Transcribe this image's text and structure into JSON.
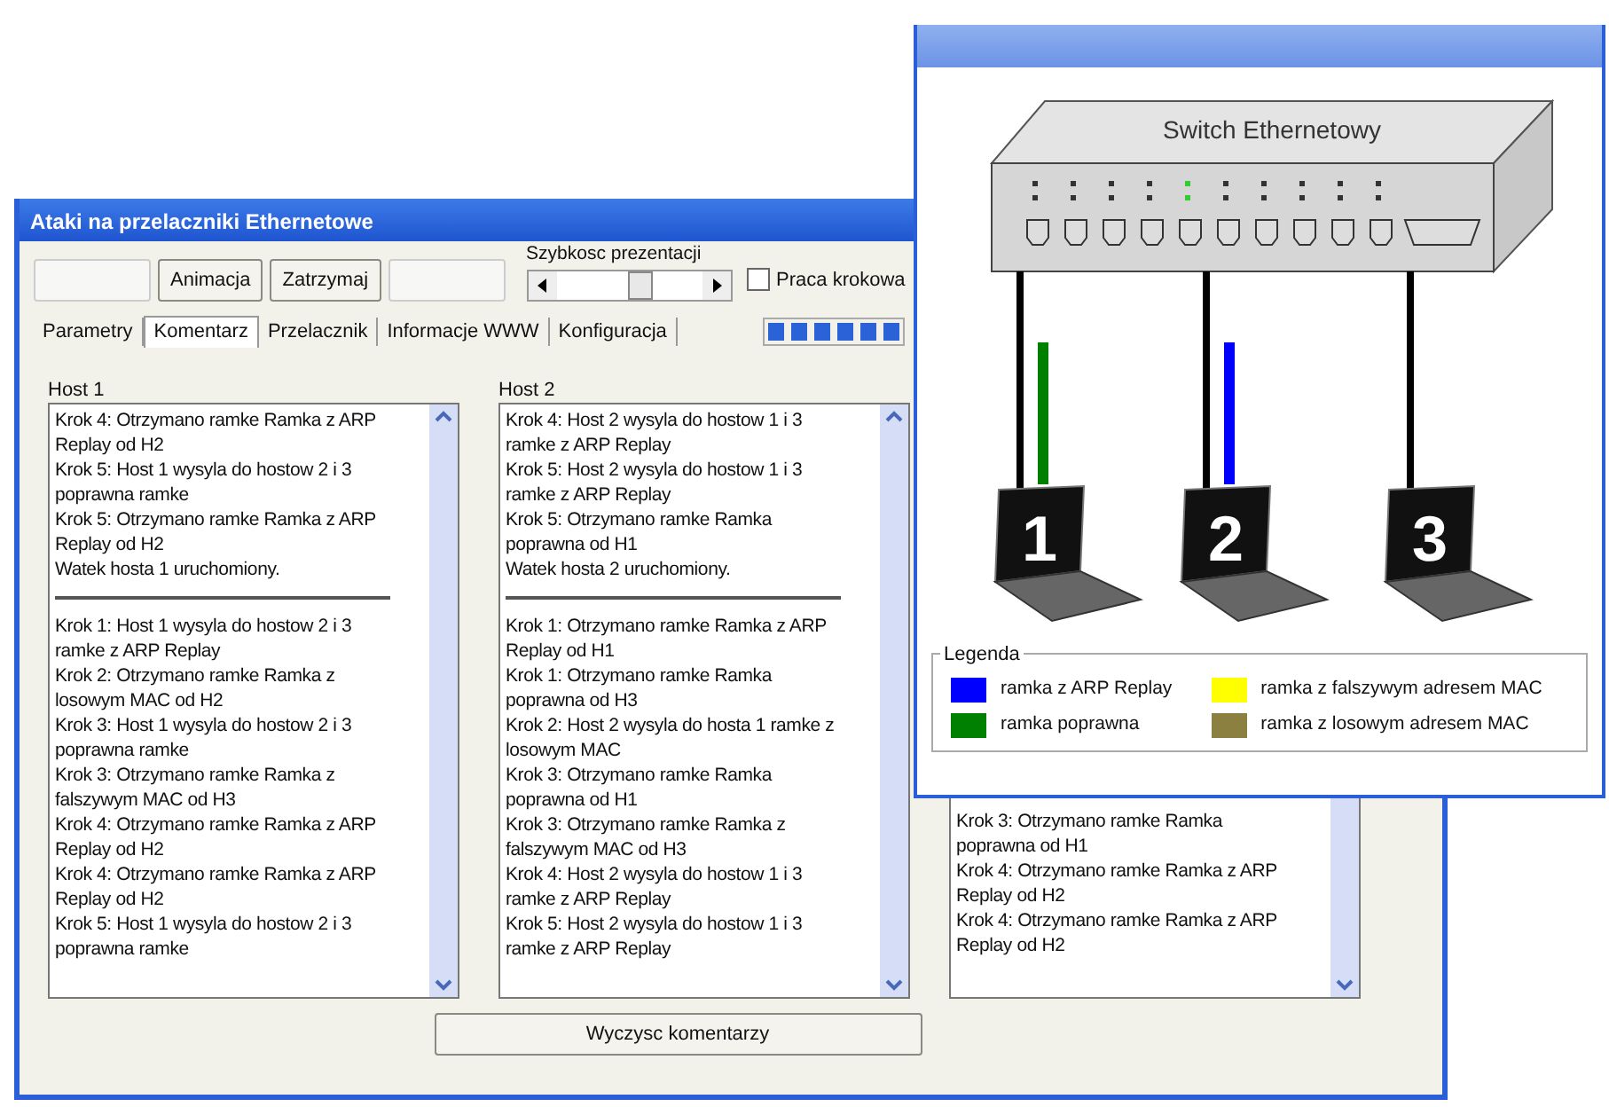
{
  "main_window": {
    "title": "Ataki na przelaczniki Ethernetowe",
    "toolbar": [
      {
        "kind": "button",
        "disabled": true
      },
      {
        "kind": "button",
        "label": "Animacja",
        "disabled": false
      },
      {
        "kind": "button",
        "label": "Zatrzymaj",
        "disabled": false
      },
      {
        "kind": "button",
        "disabled": true
      }
    ],
    "speed": {
      "label": "Szybkosc prezentacji",
      "level": 0.6
    },
    "progress": {
      "level": 1
    },
    "step_mode": {
      "label": "Praca krokowa",
      "checked": false
    },
    "tabs": [
      {
        "label": "Parametry",
        "selected": false
      },
      {
        "label": "Komentarz",
        "selected": true
      },
      {
        "label": "Przelacznik",
        "selected": false
      },
      {
        "label": "Informacje WWW",
        "selected": false
      },
      {
        "label": "Konfiguracja",
        "selected": false
      }
    ],
    "hosts": [
      {
        "title": "Host 1",
        "sections": [
          [
            "Krok 4: Otrzymano ramke Ramka z ARP Replay od H2",
            "Krok 5: Host 1 wysyla do hostow 2 i 3 poprawna ramke",
            "Krok 5: Otrzymano ramke Ramka z ARP Replay od H2",
            "Watek hosta 1 uruchomiony."
          ],
          [
            "Krok 1: Host 1 wysyla do hostow 2 i 3 ramke z ARP Replay",
            "Krok 2: Otrzymano ramke Ramka z losowym MAC od H2",
            "Krok 3: Host 1 wysyla do hostow 2 i 3 poprawna ramke",
            "Krok 3: Otrzymano ramke Ramka z falszywym MAC od H3",
            "Krok 4: Otrzymano ramke Ramka z ARP Replay od H2",
            "Krok 4: Otrzymano ramke Ramka z ARP Replay od H2",
            "Krok 5: Host 1 wysyla do hostow 2 i 3 poprawna ramke"
          ]
        ]
      },
      {
        "title": "Host 2",
        "sections": [
          [
            "Krok 4: Host 2 wysyla do hostow 1 i 3 ramke z ARP Replay",
            "Krok 5: Host 2 wysyla do hostow 1 i 3 ramke z ARP Replay",
            "Krok 5: Otrzymano ramke Ramka poprawna od H1",
            "Watek hosta 2 uruchomiony."
          ],
          [
            "Krok 1: Otrzymano ramke Ramka z ARP Replay od H1",
            "Krok 1: Otrzymano ramke Ramka poprawna od H3",
            "Krok 2: Host 2 wysyla do hosta 1 ramke z losowym MAC",
            "Krok 3: Otrzymano ramke Ramka poprawna od H1",
            "Krok 3: Otrzymano ramke Ramka z falszywym MAC od H3",
            "Krok 4: Host 2 wysyla do hostow 1 i 3 ramke z ARP Replay",
            "Krok 5: Host 2 wysyla do hostow 1 i 3 ramke z ARP Replay"
          ]
        ]
      },
      {
        "sections": [
          [
            "Krok 3: Otrzymano ramke Ramka poprawna od H1",
            "Krok 4: Otrzymano ramke Ramka z ARP Replay od H2",
            "Krok 4: Otrzymano ramke Ramka z ARP Replay od H2"
          ]
        ]
      }
    ],
    "clear_button": "Wyczysc komentarzy"
  },
  "diagram_window": {
    "switch_label": "Switch Ethernetowy",
    "hosts": [
      {
        "label": "1",
        "color": "#008000"
      },
      {
        "label": "2",
        "color": "#0000ff"
      },
      {
        "label": "3"
      }
    ],
    "legend": {
      "title": "Legenda",
      "items": [
        {
          "label": "ramka z ARP Replay",
          "color": "#0000ff"
        },
        {
          "label": "ramka z falszywym adresem MAC",
          "color": "#ffff00"
        },
        {
          "label": "ramka poprawna",
          "color": "#008000"
        },
        {
          "label": "ramka z losowym adresem MAC",
          "color": "#8b8040"
        }
      ]
    }
  }
}
